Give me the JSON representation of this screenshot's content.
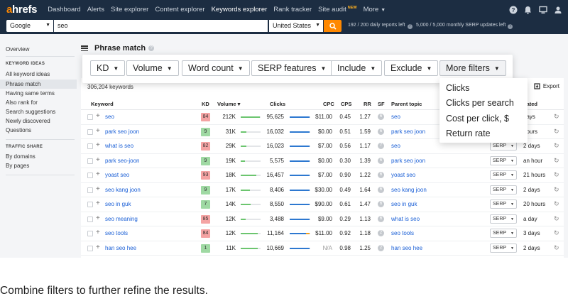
{
  "topnav": {
    "logo_a": "a",
    "logo_rest": "hrefs",
    "items": [
      {
        "label": "Dashboard",
        "active": false
      },
      {
        "label": "Alerts",
        "active": false
      },
      {
        "label": "Site explorer",
        "active": false
      },
      {
        "label": "Content explorer",
        "active": false
      },
      {
        "label": "Keywords explorer",
        "active": true
      },
      {
        "label": "Rank tracker",
        "active": false
      },
      {
        "label": "Site audit",
        "active": false,
        "badge": "NEW"
      },
      {
        "label": "More",
        "active": false,
        "dropdown": true
      }
    ],
    "icons": [
      "help-icon",
      "bell-icon",
      "desktop-icon",
      "user-icon"
    ]
  },
  "searchbar": {
    "engine": "Google",
    "query": "seo",
    "country": "United States",
    "reports_left": "192 / 200 daily reports left",
    "serp_left": "5,000 / 5,000 monthly SERP updates left"
  },
  "sidebar": {
    "overview": "Overview",
    "keyword_ideas_head": "KEYWORD IDEAS",
    "items": [
      "All keyword ideas",
      "Phrase match",
      "Having same terms",
      "Also rank for",
      "Search suggestions",
      "Newly discovered",
      "Questions"
    ],
    "active_index": 1,
    "traffic_head": "TRAFFIC SHARE",
    "traffic_items": [
      "By domains",
      "By pages"
    ]
  },
  "main": {
    "title": "Phrase match",
    "keyword_count": "306,204 keywords",
    "export_label": "Export"
  },
  "filters": {
    "buttons": [
      "KD",
      "Volume",
      "Word count",
      "SERP features",
      "Include",
      "Exclude",
      "More filters"
    ]
  },
  "more_filters_menu": {
    "items": [
      "Clicks",
      "Clicks per search",
      "Cost per click, $",
      "Return rate"
    ]
  },
  "table": {
    "headers": {
      "keyword": "Keyword",
      "kd": "KD",
      "volume": "Volume ▾",
      "clicks": "Clicks",
      "cpc": "CPC",
      "cps": "CPS",
      "rr": "RR",
      "sf": "SF",
      "parent": "Parent topic",
      "updated": "dated"
    },
    "rows": [
      {
        "keyword": "seo",
        "kd": "84",
        "kd_color": "#f4a3a3",
        "volume": "212K",
        "vol_fill": 0.95,
        "clicks": "95,625",
        "click_fill": 0.95,
        "click_paid": 0.0,
        "cpc": "$11.00",
        "cps": "0.45",
        "rr": "1.27",
        "sf": "6",
        "parent": "seo",
        "serp": "SERP",
        "updated": "days"
      },
      {
        "keyword": "park seo joon",
        "kd": "9",
        "kd_color": "#9fd9a3",
        "volume": "31K",
        "vol_fill": 0.3,
        "clicks": "16,032",
        "click_fill": 0.95,
        "click_paid": 0.0,
        "cpc": "$0.00",
        "cps": "0.51",
        "rr": "1.59",
        "sf": "6",
        "parent": "park seo joon",
        "serp": "SERP",
        "updated": "hours"
      },
      {
        "keyword": "what is seo",
        "kd": "82",
        "kd_color": "#f4a3a3",
        "volume": "29K",
        "vol_fill": 0.28,
        "clicks": "16,023",
        "click_fill": 0.95,
        "click_paid": 0.0,
        "cpc": "$7.00",
        "cps": "0.56",
        "rr": "1.17",
        "sf": "7",
        "parent": "seo",
        "serp": "SERP",
        "updated": "2 days"
      },
      {
        "keyword": "park seo-joon",
        "kd": "9",
        "kd_color": "#9fd9a3",
        "volume": "19K",
        "vol_fill": 0.2,
        "clicks": "5,575",
        "click_fill": 0.95,
        "click_paid": 0.0,
        "cpc": "$0.00",
        "cps": "0.30",
        "rr": "1.39",
        "sf": "6",
        "parent": "park seo joon",
        "serp": "SERP",
        "updated": "an hour"
      },
      {
        "keyword": "yoast seo",
        "kd": "93",
        "kd_color": "#f4a3a3",
        "volume": "18K",
        "vol_fill": 0.8,
        "clicks": "16,457",
        "click_fill": 0.95,
        "click_paid": 0.0,
        "cpc": "$7.00",
        "cps": "0.90",
        "rr": "1.22",
        "sf": "6",
        "parent": "yoast seo",
        "serp": "SERP",
        "updated": "21 hours"
      },
      {
        "keyword": "seo kang joon",
        "kd": "9",
        "kd_color": "#9fd9a3",
        "volume": "17K",
        "vol_fill": 0.45,
        "clicks": "8,406",
        "click_fill": 0.95,
        "click_paid": 0.0,
        "cpc": "$30.00",
        "cps": "0.49",
        "rr": "1.64",
        "sf": "6",
        "parent": "seo kang joon",
        "serp": "SERP",
        "updated": "2 days"
      },
      {
        "keyword": "seo in guk",
        "kd": "7",
        "kd_color": "#9fd9a3",
        "volume": "14K",
        "vol_fill": 0.5,
        "clicks": "8,550",
        "click_fill": 0.95,
        "click_paid": 0.0,
        "cpc": "$90.00",
        "cps": "0.61",
        "rr": "1.47",
        "sf": "6",
        "parent": "seo in guk",
        "serp": "SERP",
        "updated": "20 hours"
      },
      {
        "keyword": "seo meaning",
        "kd": "85",
        "kd_color": "#f4a3a3",
        "volume": "12K",
        "vol_fill": 0.25,
        "clicks": "3,488",
        "click_fill": 0.95,
        "click_paid": 0.0,
        "cpc": "$9.00",
        "cps": "0.29",
        "rr": "1.13",
        "sf": "6",
        "parent": "what is seo",
        "serp": "SERP",
        "updated": "a day"
      },
      {
        "keyword": "seo tools",
        "kd": "84",
        "kd_color": "#f4a3a3",
        "volume": "12K",
        "vol_fill": 0.85,
        "clicks": "11,164",
        "click_fill": 0.8,
        "click_paid": 0.15,
        "cpc": "$11.00",
        "cps": "0.92",
        "rr": "1.18",
        "sf": "2",
        "parent": "seo tools",
        "serp": "SERP",
        "updated": "3 days"
      },
      {
        "keyword": "han seo hee",
        "kd": "1",
        "kd_color": "#9fd9a3",
        "volume": "11K",
        "vol_fill": 0.85,
        "clicks": "10,669",
        "click_fill": 0.95,
        "click_paid": 0.0,
        "cpc": "N/A",
        "cps": "0.98",
        "rr": "1.25",
        "sf": "2",
        "parent": "han seo hee",
        "serp": "SERP",
        "updated": "2 days"
      }
    ]
  },
  "caption": "Combine filters to further refine the results."
}
